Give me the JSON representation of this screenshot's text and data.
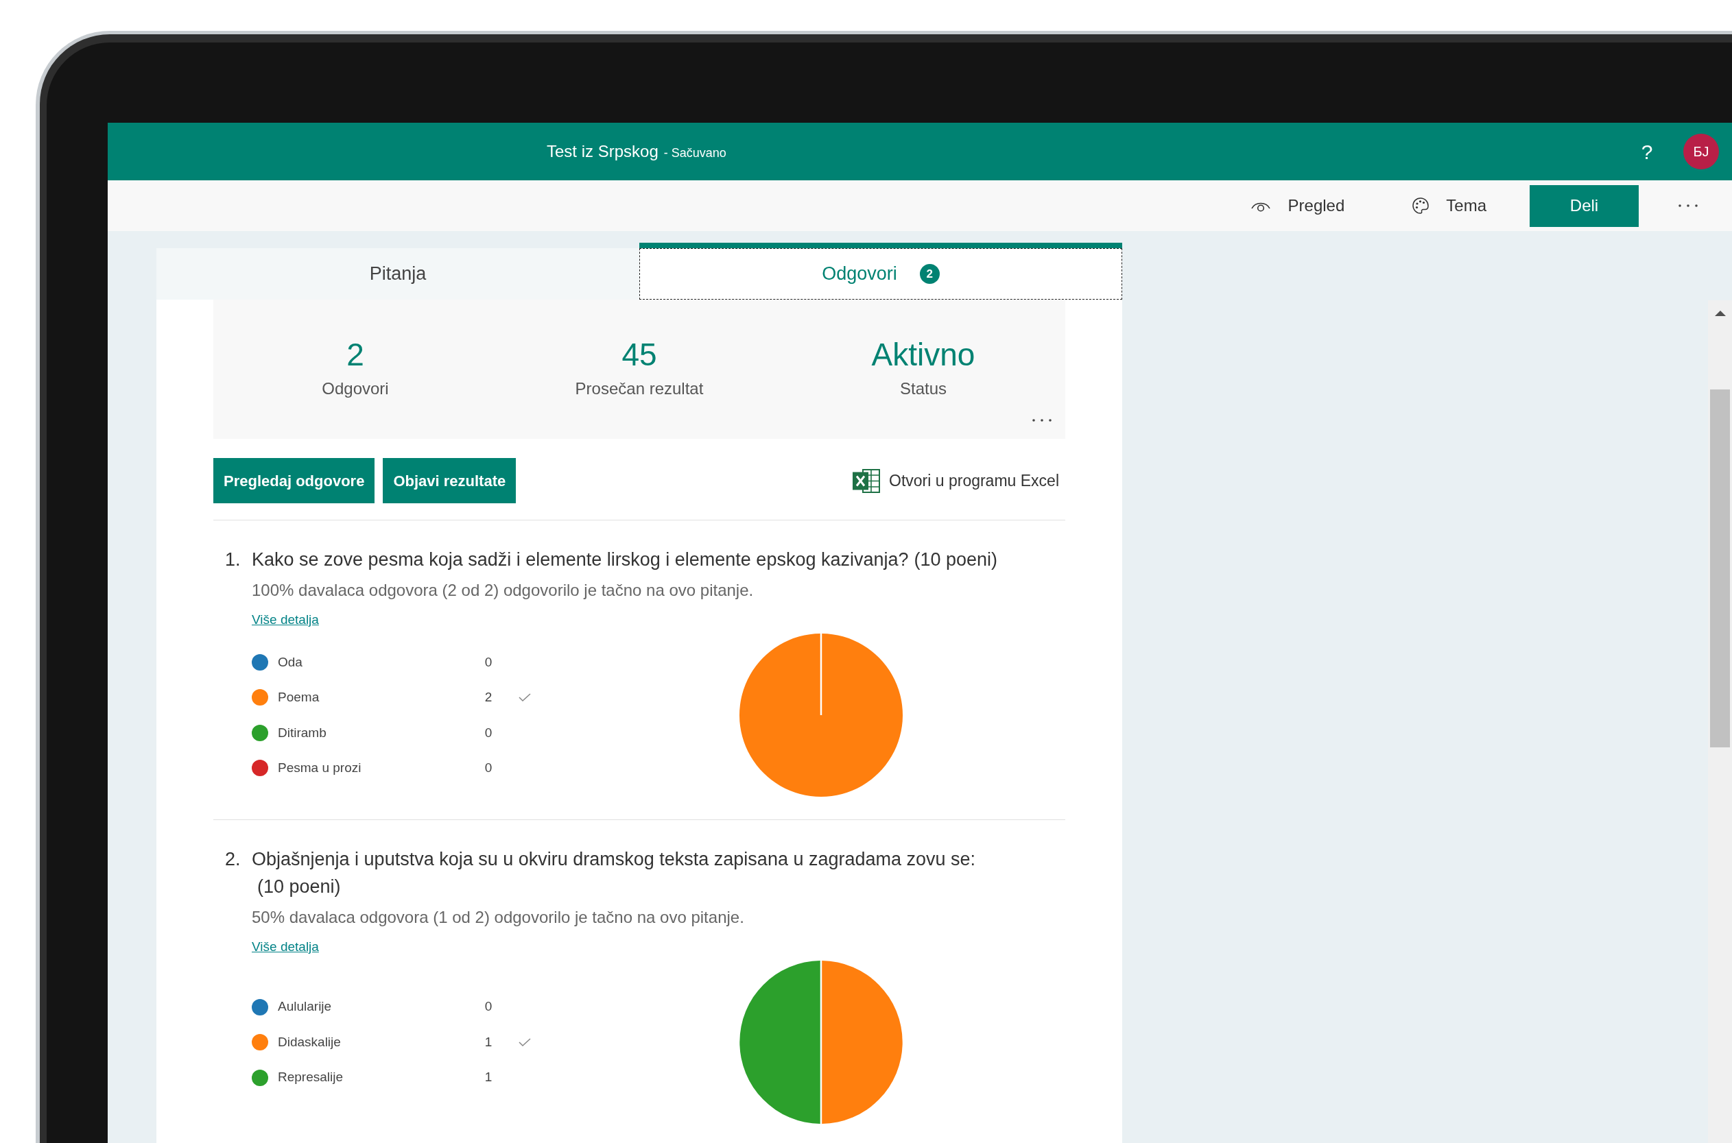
{
  "header": {
    "title": "Test iz Srpskog",
    "save_status": "- Sačuvano",
    "help": "?",
    "avatar": "БЈ"
  },
  "toolbar": {
    "preview": "Pregled",
    "theme": "Tema",
    "share": "Deli"
  },
  "tabs": [
    {
      "label": "Pitanja",
      "selected": false
    },
    {
      "label": "Odgovori",
      "selected": true,
      "badge": "2"
    }
  ],
  "summary": {
    "stats": [
      {
        "value": "2",
        "label": "Odgovori"
      },
      {
        "value": "45",
        "label": "Prosečan rezultat"
      },
      {
        "value": "Aktivno",
        "label": "Status"
      }
    ]
  },
  "actions": {
    "buttons": [
      "Pregledaj odgovore",
      "Objavi rezultate"
    ],
    "excel_link": "Otvori u programu Excel"
  },
  "questions": [
    {
      "number": "1.",
      "title": "Kako se zove pesma koja sadži i elemente lirskog i elemente epskog kazivanja?",
      "points": "(10 poeni)",
      "result": "100% davalaca odgovora (2 od 2) odgovorilo je tačno na ovo pitanje.",
      "details_link": "Više detalja",
      "answers": [
        {
          "color": "#1f77b4",
          "correct": false
        },
        {
          "color": "#ff7f0e",
          "correct": true
        },
        {
          "color": "#2ca02c",
          "correct": false
        },
        {
          "color": "#d62728",
          "correct": false
        }
      ],
      "chart_data": {
        "type": "pie",
        "categories": [
          "Oda",
          "Poema",
          "Ditiramb",
          "Pesma u prozi"
        ],
        "values": [
          0,
          2,
          0,
          0
        ],
        "value_labels": [
          "0",
          "2",
          "0",
          "0"
        ],
        "legend": "left"
      }
    },
    {
      "number": "2.",
      "title": "Objašnjenja i uputstva koja su u okviru dramskog teksta zapisana u zagradama zovu se:",
      "points": "(10 poeni)",
      "result": "50% davalaca odgovora (1 od 2) odgovorilo je tačno na ovo pitanje.",
      "details_link": "Više detalja",
      "answers": [
        {
          "color": "#1f77b4",
          "correct": false
        },
        {
          "color": "#ff7f0e",
          "correct": true
        },
        {
          "color": "#2ca02c",
          "correct": false
        }
      ],
      "chart_data": {
        "type": "pie",
        "categories": [
          "Aulularije",
          "Didaskalije",
          "Represalije"
        ],
        "values": [
          0,
          1,
          1
        ],
        "value_labels": [
          "0",
          "1",
          "1"
        ],
        "legend": "left"
      }
    }
  ]
}
